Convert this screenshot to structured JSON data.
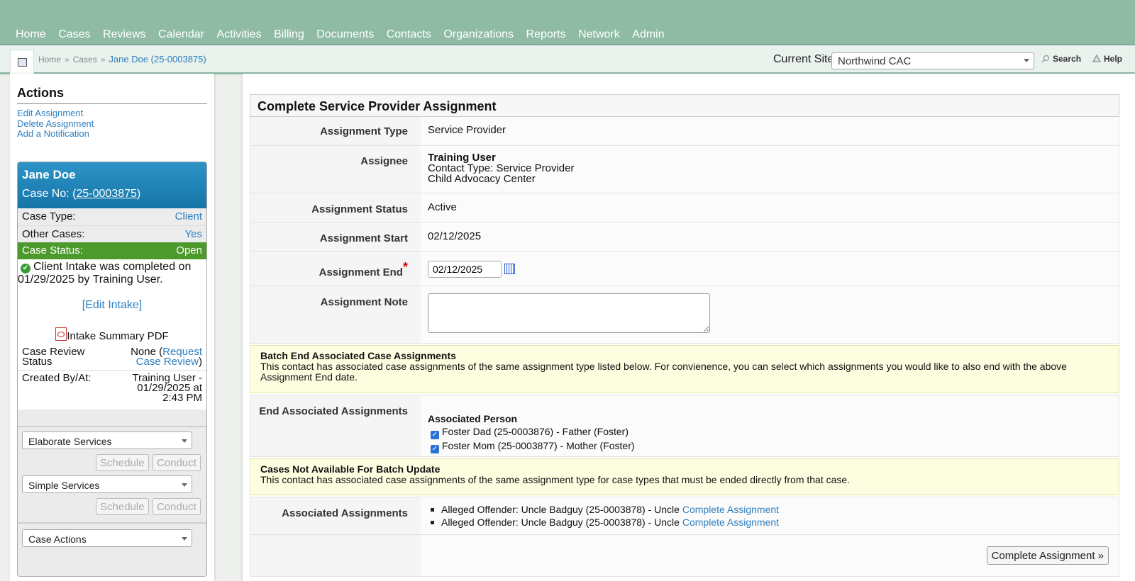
{
  "nav": {
    "items": [
      "Home",
      "Cases",
      "Reviews",
      "Calendar",
      "Activities",
      "Billing",
      "Documents",
      "Contacts",
      "Organizations",
      "Reports",
      "Network",
      "Admin"
    ]
  },
  "breadcrumb": {
    "home": "Home",
    "cases": "Cases",
    "current": "Jane Doe (25-0003875)"
  },
  "site": {
    "label": "Current Site",
    "value": "Northwind CAC"
  },
  "header_links": {
    "search": "Search",
    "help": "Help"
  },
  "sidebar": {
    "actions_title": "Actions",
    "actions": [
      "Edit Assignment",
      "Delete Assignment",
      "Add a Notification"
    ],
    "case": {
      "name": "Jane Doe",
      "case_no_prefix": "Case No: (",
      "case_no": "25-0003875",
      "case_no_suffix": ")",
      "case_type_label": "Case Type:",
      "case_type": "Client",
      "other_cases_label": "Other Cases:",
      "other_cases": "Yes",
      "status_label": "Case Status:",
      "status": "Open",
      "intake_msg": "Client Intake was completed on 01/29/2025 by Training User.",
      "edit_intake": "[Edit Intake]",
      "pdf_label": "Intake Summary PDF",
      "review_label": "Case Review Status",
      "review_none": "None (",
      "review_link": "Request Case Review",
      "review_close": ")",
      "created_label": "Created By/At:",
      "created_value": "Training User - 01/29/2025 at 2:43 PM"
    },
    "services": [
      {
        "name": "Elaborate Services",
        "schedule": "Schedule",
        "conduct": "Conduct"
      },
      {
        "name": "Simple Services",
        "schedule": "Schedule",
        "conduct": "Conduct"
      }
    ],
    "case_actions": "Case Actions"
  },
  "form": {
    "title": "Complete Service Provider Assignment",
    "assignment_type_label": "Assignment Type",
    "assignment_type": "Service Provider",
    "assignee_label": "Assignee",
    "assignee_name": "Training User",
    "assignee_contact_type": "Contact Type: Service Provider",
    "assignee_org": "Child Advocacy Center",
    "status_label": "Assignment Status",
    "status": "Active",
    "start_label": "Assignment Start",
    "start": "02/12/2025",
    "end_label": "Assignment End",
    "end": "02/12/2025",
    "note_label": "Assignment Note",
    "note": "",
    "batch_title": "Batch End Associated Case Assignments",
    "batch_text": "This contact has associated case assignments of the same assignment type listed below. For convienence, you can select which assignments you would like to also end with the above Assignment End date.",
    "end_assoc_label": "End Associated Assignments",
    "assoc_person_header": "Associated Person",
    "assoc_people": [
      "Foster Dad (25-0003876) - Father (Foster)",
      "Foster Mom (25-0003877) - Mother (Foster)"
    ],
    "unavailable_title": "Cases Not Available For Batch Update",
    "unavailable_text": "This contact has associated case assignments of the same assignment type for case types that must be ended directly from that case.",
    "assoc_assign_label": "Associated Assignments",
    "assoc_assignments": [
      {
        "text": "Alleged Offender: Uncle Badguy (25-0003878) - Uncle ",
        "link": "Complete Assignment"
      },
      {
        "text": "Alleged Offender: Uncle Badguy (25-0003878) - Uncle ",
        "link": "Complete Assignment"
      }
    ],
    "submit": "Complete Assignment »"
  }
}
